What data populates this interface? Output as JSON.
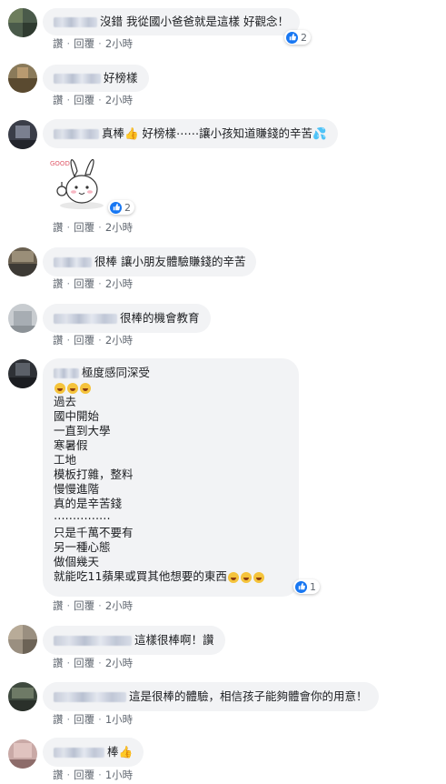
{
  "actions": {
    "like": "讚",
    "reply": "回覆",
    "separator": "·"
  },
  "comments": [
    {
      "text": "沒錯 我從國小爸爸就是這樣 好觀念！",
      "reactions": "2",
      "time": "2小時"
    },
    {
      "text": "好榜樣",
      "time": "2小時"
    },
    {
      "text": "真棒👍 好榜樣⋯⋯讓小孩知道賺錢的辛苦💦",
      "reactions": "2",
      "time": "2小時",
      "sticker": "rabbit-good-sticker"
    },
    {
      "text": "很棒 讓小朋友體驗賺錢的辛苦",
      "time": "2小時"
    },
    {
      "text": "很棒的機會教育",
      "time": "2小時"
    },
    {
      "first_line": "極度感同深受",
      "lines": [
        "過去",
        "國中開始",
        "一直到大學",
        "寒暑假",
        "工地",
        "模板打雜，整料",
        "慢慢進階",
        "真的是辛苦錢",
        "⋯⋯⋯⋯⋯",
        "只是千萬不要有",
        "另一種心態",
        "做個幾天"
      ],
      "last_line": "就能吃11蘋果或買其他想要的東西",
      "reactions": "1",
      "time": "2小時"
    },
    {
      "text": "這樣很棒啊！讚",
      "time": "2小時"
    },
    {
      "text": "這是很棒的體驗，相信孩子能夠體會你的用意！",
      "time": "1小時"
    },
    {
      "text": "棒👍",
      "time": "1小時"
    }
  ],
  "colors": {
    "like_blue": "#1877f2",
    "bubble": "#f2f3f5",
    "meta": "#606770"
  }
}
